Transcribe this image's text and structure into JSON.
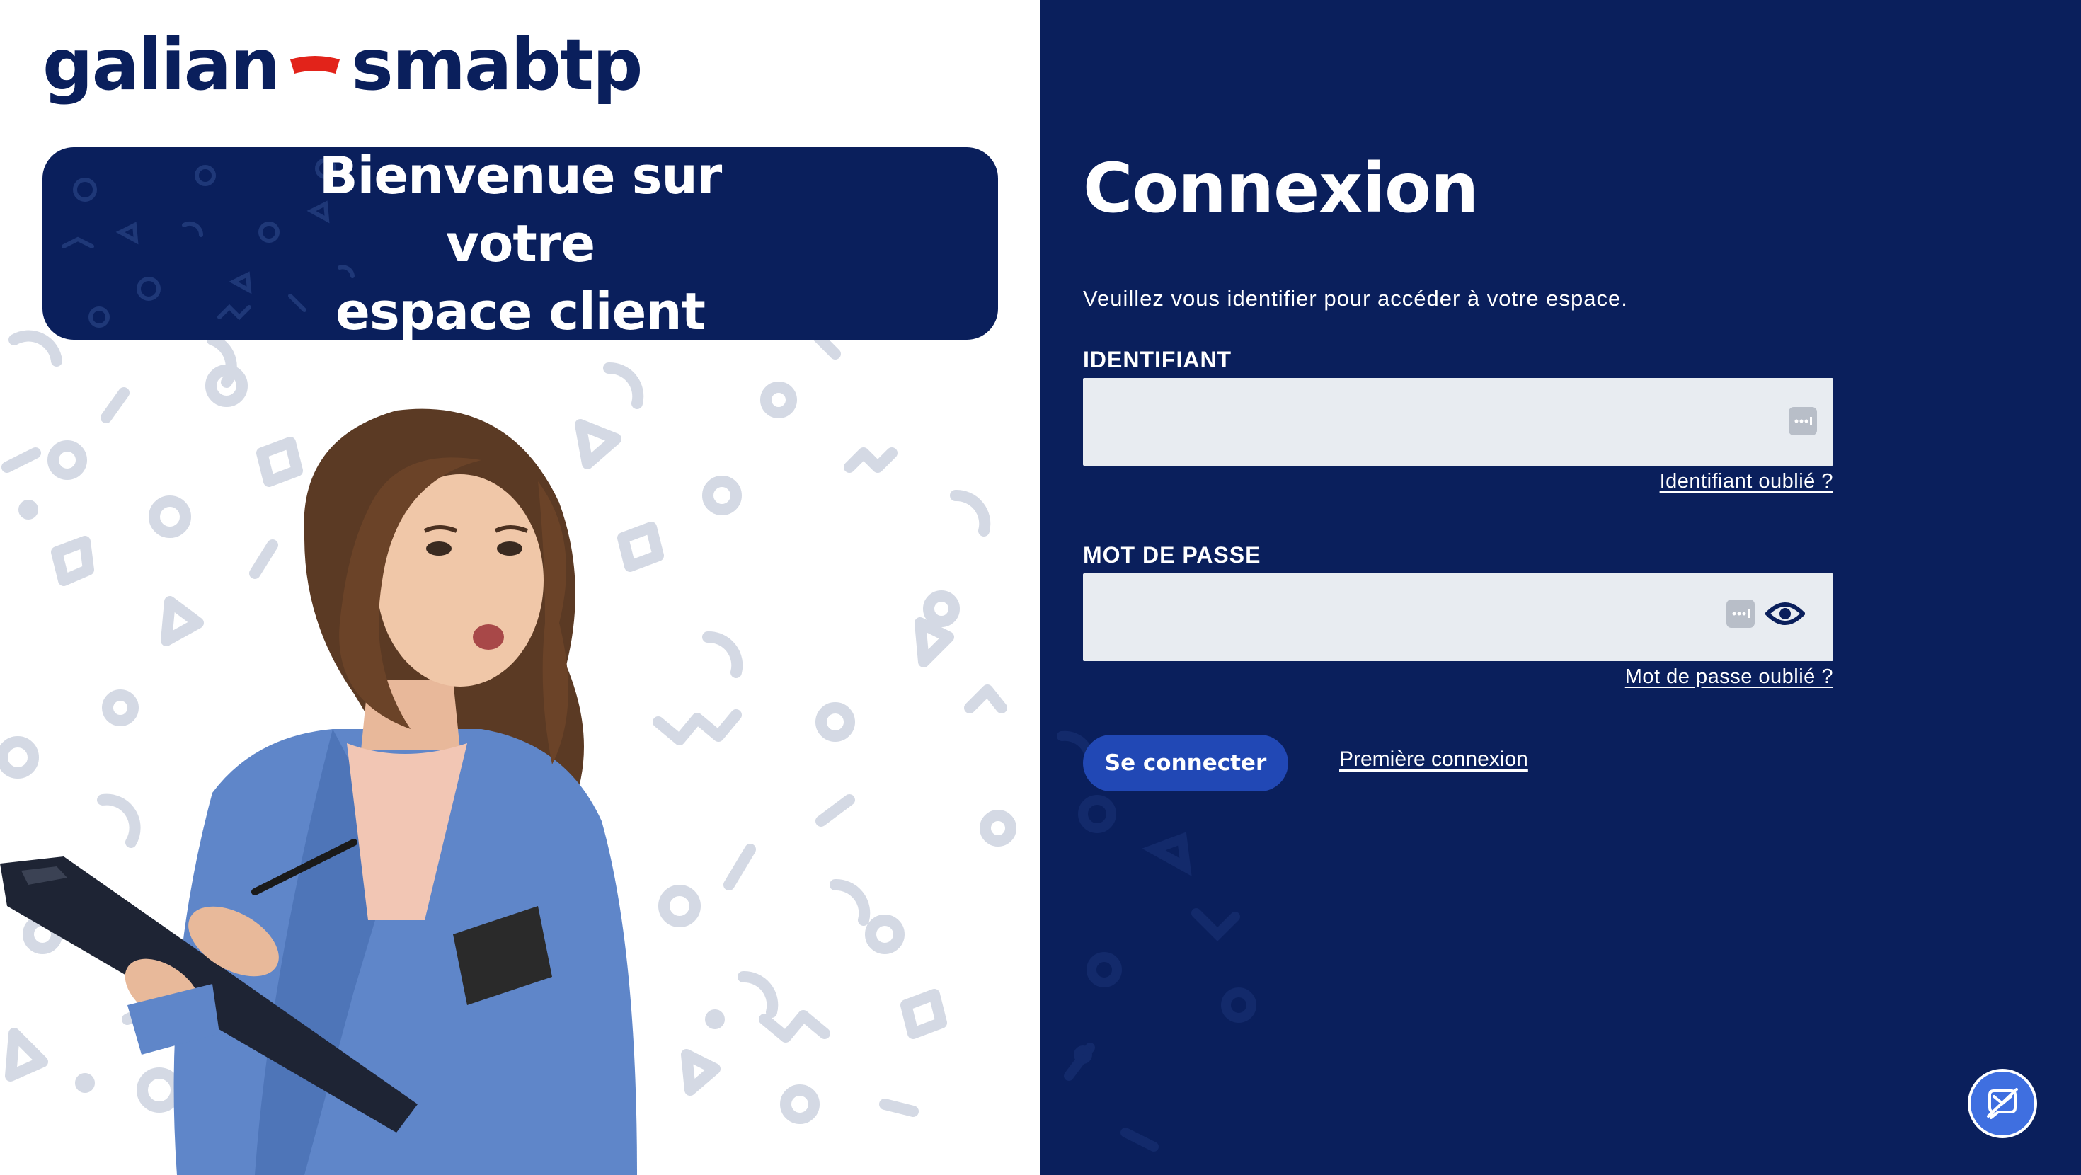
{
  "brand": {
    "logo_left": "galian",
    "logo_right": "smabtp",
    "primary_color": "#0a1f5c",
    "accent_color": "#e2231a",
    "button_color": "#2148b5"
  },
  "welcome": {
    "line1": "Bienvenue sur votre",
    "line2": "espace client"
  },
  "login": {
    "title": "Connexion",
    "subtitle": "Veuillez vous identifier pour accéder à votre espace.",
    "identifier": {
      "label": "IDENTIFIANT",
      "value": "",
      "forgot_link": "Identifiant oublié ?",
      "icon": "password-manager-icon"
    },
    "password": {
      "label": "MOT DE PASSE",
      "value": "",
      "forgot_link": "Mot de passe oublié ?",
      "icons": [
        "password-manager-icon",
        "eye-icon"
      ]
    },
    "submit_label": "Se connecter",
    "first_login_link": "Première connexion"
  },
  "help_widget": {
    "icon": "chat-support-icon"
  }
}
